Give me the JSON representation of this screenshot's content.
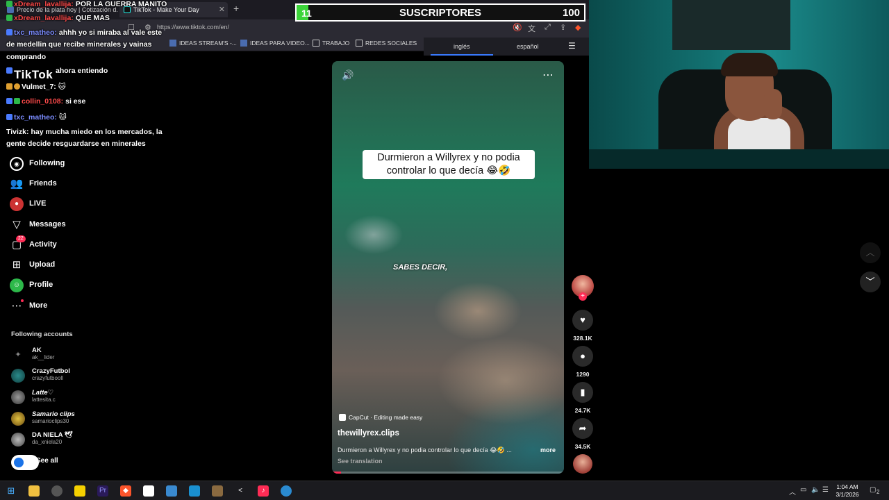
{
  "browser": {
    "tabs": [
      {
        "label": "Precio de la plata hoy | Cotización d..."
      },
      {
        "label": "TikTok - Make Your Day",
        "close": "✕"
      }
    ],
    "new_tab": "+",
    "url": "https://www.tiktok.com/en/",
    "bookmarks": [
      {
        "label": "IDEAS STREAM'S -..."
      },
      {
        "label": "IDEAS PARA VIDEO..."
      },
      {
        "label": "TRABAJO"
      },
      {
        "label": "REDES SOCIALES"
      }
    ]
  },
  "translate_bar": {
    "lang_from": "inglés",
    "lang_to": "español"
  },
  "subscriber_goal": {
    "current": "11",
    "label": "SUSCRIPTORES",
    "goal": "100",
    "progress": 0.11,
    "fill_color": "#3cd43a"
  },
  "chat": [
    {
      "user": "xDream_lavallija:",
      "text": "POR LA GUERRA MANITO",
      "color": "#ff4a4a"
    },
    {
      "user": "xDream_lavallija:",
      "text": "QUE MAS",
      "color": "#ff4a4a"
    },
    {
      "user": "txc_matheo:",
      "text": "ahhh yo si miraba al vale este",
      "color": "#7b8cff"
    },
    {
      "user": "",
      "text": "de medellin que recibe minerales y vainas",
      "color": "#ffffff"
    },
    {
      "user": "",
      "text": "comprando",
      "color": "#ffffff"
    },
    {
      "user": "",
      "text": "ahora entiendo",
      "color": "#7b8cff"
    },
    {
      "user": "Vulmet_7:",
      "text": "",
      "color": "#ffffff"
    },
    {
      "user": "collin_0108:",
      "text": "si ese",
      "color": "#ff4a4a"
    },
    {
      "user": "txc_matheo:",
      "text": "",
      "color": "#7b8cff"
    },
    {
      "user": "Tivizk:",
      "text": "hay mucha miedo en los mercados, la",
      "color": "#ffffff"
    },
    {
      "user": "",
      "text": "gente decide resguardarse en minerales",
      "color": "#ffffff"
    }
  ],
  "tiktok": {
    "logo": "TikTok",
    "nav": [
      {
        "label": "Following",
        "icon": "following-icon"
      },
      {
        "label": "Friends",
        "icon": "friends-icon"
      },
      {
        "label": "LIVE",
        "icon": "live-icon"
      },
      {
        "label": "Messages",
        "icon": "messages-icon"
      },
      {
        "label": "Activity",
        "icon": "activity-icon",
        "badge": "22"
      },
      {
        "label": "Upload",
        "icon": "upload-icon"
      },
      {
        "label": "Profile",
        "icon": "profile-icon"
      },
      {
        "label": "More",
        "icon": "more-icon"
      }
    ],
    "following_title": "Following accounts",
    "accounts": [
      {
        "name": "AK",
        "handle": "ak__lider"
      },
      {
        "name": "CrazyFutbol",
        "handle": "crazyfutbooll"
      },
      {
        "name": "Latte♡",
        "handle": "lattesita.c"
      },
      {
        "name": "Samario clips",
        "handle": "samarioclips30"
      },
      {
        "name": "DA NIELA 🕊",
        "handle": "da_xniela20"
      }
    ],
    "see_all": "See all"
  },
  "video": {
    "caption_line1": "Durmieron a Willyrex y no podia",
    "caption_line2": "controlar lo que decía 😂🤣",
    "subtitle": "SABES DECIR,",
    "capcut": "CapCut · Editing made easy",
    "author": "thewillyrex.clips",
    "description": "Durmieron a Willyrex y no podia controlar lo que decía 😂🤣 ...",
    "more": "more",
    "see_translation": "See translation",
    "progress": 0.04
  },
  "actions": {
    "likes": "328.1K",
    "comments": "1290",
    "saves": "24.7K",
    "shares": "34.5K"
  },
  "taskbar": {
    "time": "1:04 AM",
    "date": "3/1/2026",
    "notifications": "2"
  }
}
